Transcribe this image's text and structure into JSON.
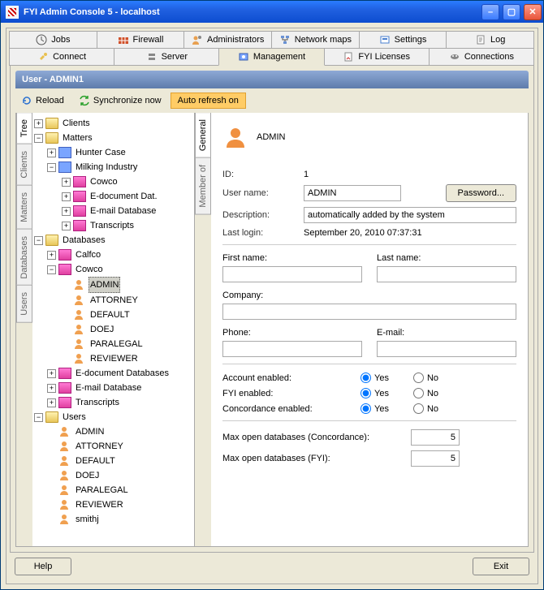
{
  "window": {
    "title": "FYI Admin Console 5 - localhost"
  },
  "tabs_row1": [
    {
      "icon": "clock",
      "label": "Jobs"
    },
    {
      "icon": "firewall",
      "label": "Firewall"
    },
    {
      "icon": "admins",
      "label": "Administrators"
    },
    {
      "icon": "netmap",
      "label": "Network maps"
    },
    {
      "icon": "settings",
      "label": "Settings"
    },
    {
      "icon": "log",
      "label": "Log"
    }
  ],
  "tabs_row2": [
    {
      "icon": "connect",
      "label": "Connect"
    },
    {
      "icon": "server",
      "label": "Server"
    },
    {
      "icon": "mgmt",
      "label": "Management",
      "active": true
    },
    {
      "icon": "license",
      "label": "FYI Licenses"
    },
    {
      "icon": "conn",
      "label": "Connections"
    }
  ],
  "panel_title": "User - ADMIN1",
  "toolbar": {
    "reload": "Reload",
    "sync": "Synchronize now",
    "auto": "Auto refresh on"
  },
  "vtabs_left": [
    "Tree",
    "Clients",
    "Matters",
    "Databases",
    "Users"
  ],
  "vtabs_right": [
    "General",
    "Member of"
  ],
  "tree": {
    "clients": "Clients",
    "matters": "Matters",
    "hunter": "Hunter Case",
    "milking": "Milking Industry",
    "cowco": "Cowco",
    "edoc": "E-document Database",
    "edoc_trunc": "E-document Dat.",
    "edocs_trunc": "E-document Databases",
    "email": "E-mail Database",
    "trans": "Transcripts",
    "databases": "Databases",
    "calfco": "Calfco",
    "users": "Users",
    "names": [
      "ADMIN",
      "ATTORNEY",
      "DEFAULT",
      "DOEJ",
      "PARALEGAL",
      "REVIEWER",
      "smithj"
    ]
  },
  "form": {
    "heading": "ADMIN",
    "id_label": "ID:",
    "id_val": "1",
    "username_label": "User name:",
    "username_val": "ADMIN",
    "password_btn": "Password...",
    "desc_label": "Description:",
    "desc_val": "automatically added by the system",
    "lastlogin_label": "Last login:",
    "lastlogin_val": "September 20, 2010  07:37:31",
    "first": "First name:",
    "last": "Last name:",
    "first_val": "",
    "last_val": "",
    "company": "Company:",
    "company_val": "",
    "phone": "Phone:",
    "email": "E-mail:",
    "phone_val": "",
    "email_val": "",
    "acc_enabled": "Account enabled:",
    "fyi_enabled": "FYI enabled:",
    "con_enabled": "Concordance enabled:",
    "yes": "Yes",
    "no": "No",
    "max_con": "Max open databases (Concordance):",
    "max_con_val": "5",
    "max_fyi": "Max open databases (FYI):",
    "max_fyi_val": "5"
  },
  "footer": {
    "help": "Help",
    "exit": "Exit"
  }
}
